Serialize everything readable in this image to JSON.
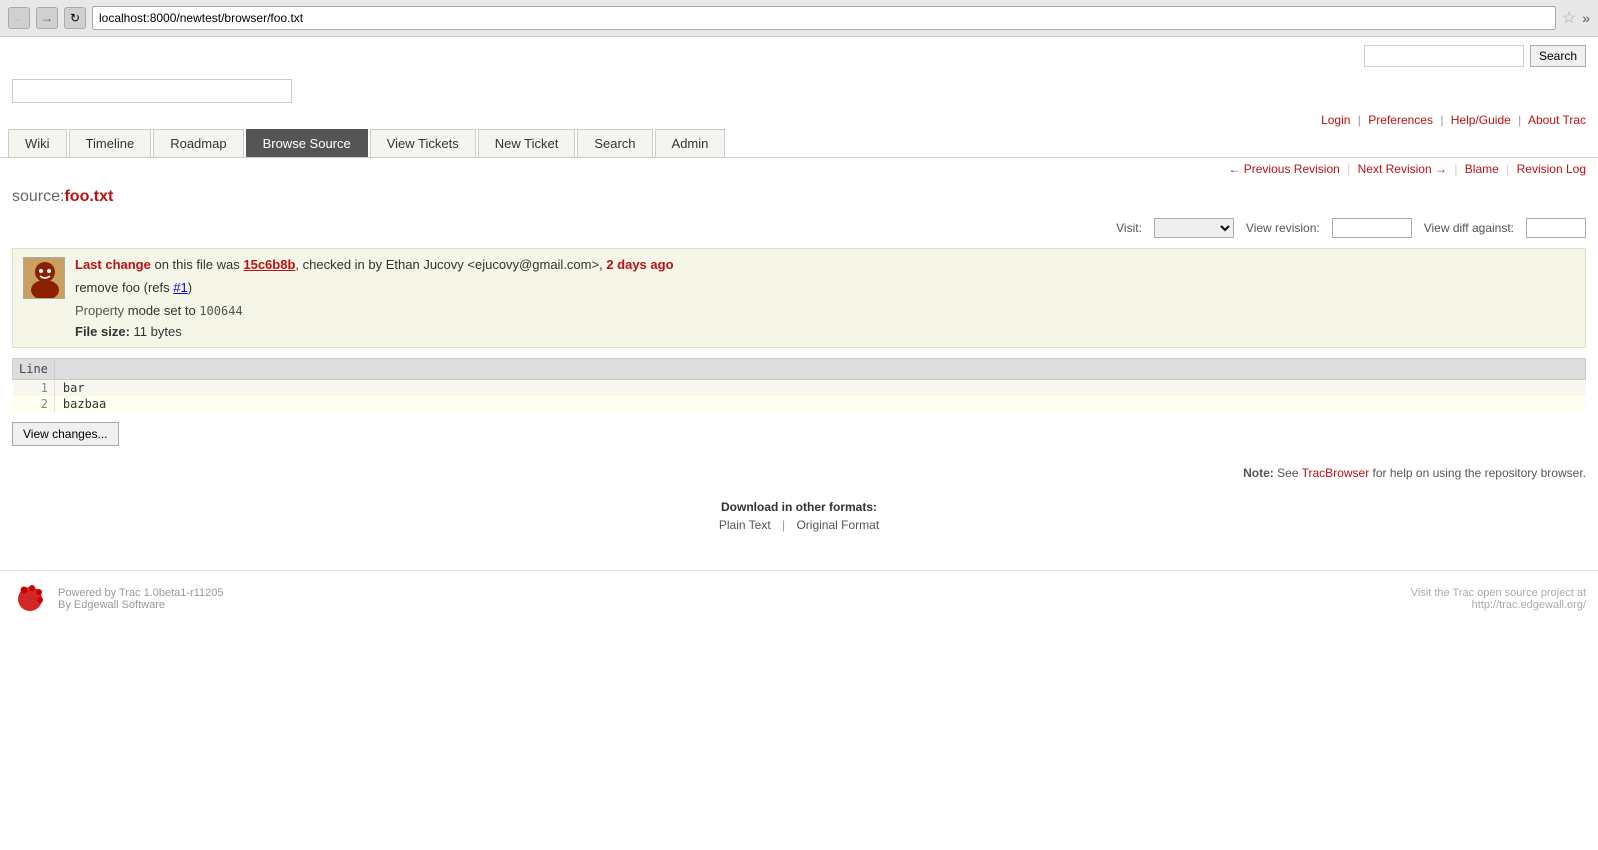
{
  "browser": {
    "url": "localhost:8000/newtest/browser/foo.txt"
  },
  "top_search": {
    "placeholder": "",
    "button_label": "Search"
  },
  "logo": {
    "input_placeholder": ""
  },
  "top_nav": {
    "links": [
      {
        "label": "Login",
        "href": "#"
      },
      {
        "label": "Preferences",
        "href": "#"
      },
      {
        "label": "Help/Guide",
        "href": "#"
      },
      {
        "label": "About Trac",
        "href": "#"
      }
    ]
  },
  "main_nav": {
    "tabs": [
      {
        "label": "Wiki",
        "active": false
      },
      {
        "label": "Timeline",
        "active": false
      },
      {
        "label": "Roadmap",
        "active": false
      },
      {
        "label": "Browse Source",
        "active": true
      },
      {
        "label": "View Tickets",
        "active": false
      },
      {
        "label": "New Ticket",
        "active": false
      },
      {
        "label": "Search",
        "active": false
      },
      {
        "label": "Admin",
        "active": false
      }
    ]
  },
  "revision_bar": {
    "previous_label": "← Previous Revision",
    "next_label": "Next Revision →",
    "blame_label": "Blame",
    "revision_log_label": "Revision Log"
  },
  "page": {
    "title_prefix": "source:",
    "title_filename": "foo.txt"
  },
  "view_controls": {
    "visit_label": "Visit:",
    "view_revision_label": "View revision:",
    "view_diff_label": "View diff against:"
  },
  "change_info": {
    "prefix_text": "Last change",
    "on_text": " on this file was ",
    "commit_hash": "15c6b8b",
    "checked_in_text": ", checked in by Ethan Jucovy <ejucovy@gmail.com>, ",
    "time_ago": "2 days ago",
    "commit_message": "remove foo (refs ",
    "ticket_ref": "#1",
    "ticket_ref_suffix": ")",
    "property_label": "Property",
    "mode_text": "mode",
    "set_to_text": " set to ",
    "mode_value": "100644"
  },
  "file_info": {
    "size_label": "File size:",
    "size_value": "11 bytes"
  },
  "file_content": {
    "column_header": "Line",
    "lines": [
      {
        "num": 1,
        "content": "bar"
      },
      {
        "num": 2,
        "content": "bazbaa"
      }
    ]
  },
  "buttons": {
    "view_changes": "View changes..."
  },
  "note": {
    "label": "Note:",
    "text": " See ",
    "link_text": "TracBrowser",
    "suffix": " for help on using the repository browser."
  },
  "download": {
    "title": "Download in other formats:",
    "formats": [
      {
        "label": "Plain Text"
      },
      {
        "label": "Original Format"
      }
    ]
  },
  "footer": {
    "powered_by": "Powered by",
    "trac_version": "Trac 1.0beta1-r11205",
    "by_text": "By",
    "edgewall": "Edgewall Software",
    "visit_text": "Visit the Trac open source project at",
    "project_url": "http://trac.edgewall.org/"
  }
}
